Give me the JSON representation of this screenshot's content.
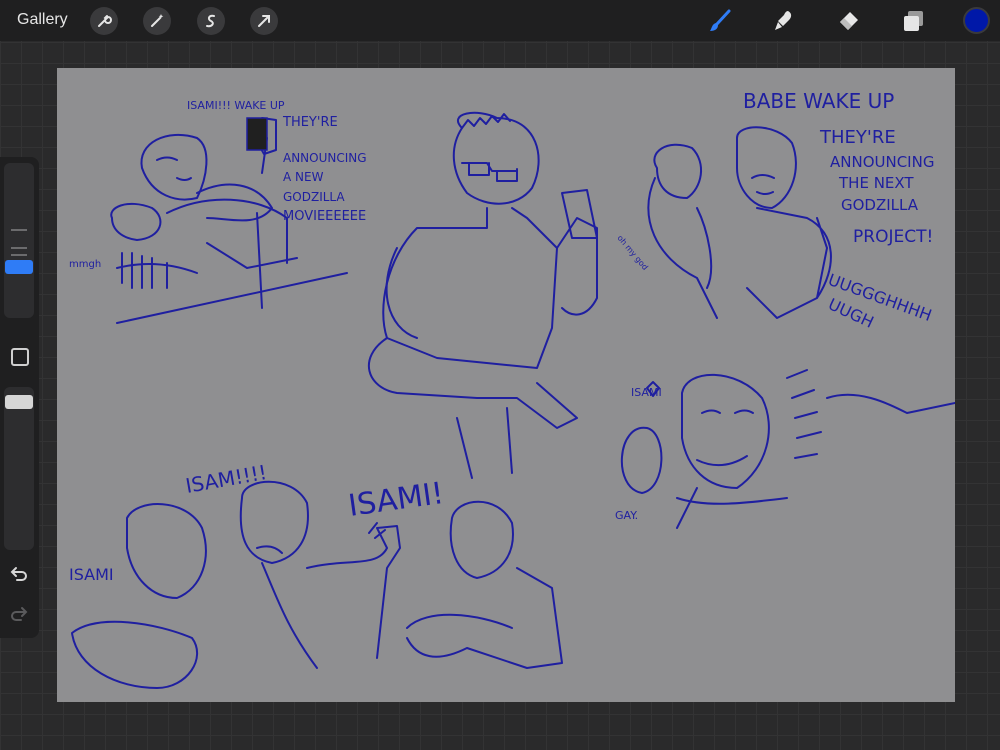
{
  "topbar": {
    "gallery_label": "Gallery",
    "left_tools": [
      "wrench-icon",
      "magic-wand-icon",
      "selection-icon",
      "transform-arrow-icon"
    ],
    "right_tools": [
      "brush-icon",
      "smudge-icon",
      "eraser-icon",
      "layers-icon"
    ],
    "active_color": "#0018a8",
    "active_tool_color": "#2f7cf6"
  },
  "sidebar": {
    "brush_size_level": 0.38,
    "opacity_level": 0.0,
    "undo_icon": "undo-icon",
    "redo_icon": "redo-icon"
  },
  "canvas": {
    "background": "#8f8f91",
    "ink_color": "#1f1fa0",
    "texts": {
      "wake1": "ISAMI!!! WAKE UP",
      "announce1_l1": "THEY'RE",
      "announce1_l2": "ANNOUNCING",
      "announce1_l3": "A NEW",
      "announce1_l4": "GODZILLA",
      "announce1_l5": "MOVIEEEEEE",
      "mmgh": "mmgh",
      "babe": "BABE WAKE UP",
      "announce2_l1": "THEY'RE",
      "announce2_l2": "ANNOUNCING",
      "announce2_l3": "THE NEXT",
      "announce2_l4": "GODZILLA",
      "announce2_l5": "PROJECT!",
      "announce2_l6": "UUGGGHHHH",
      "announce2_l7": "UUGH",
      "ohmygod": "oh my god",
      "isami_heart": "ISAMI",
      "gay": "GAY.",
      "isam_shout": "ISAM!!!!",
      "isami_left": "ISAMI",
      "isami_big": "ISAMI!"
    }
  }
}
